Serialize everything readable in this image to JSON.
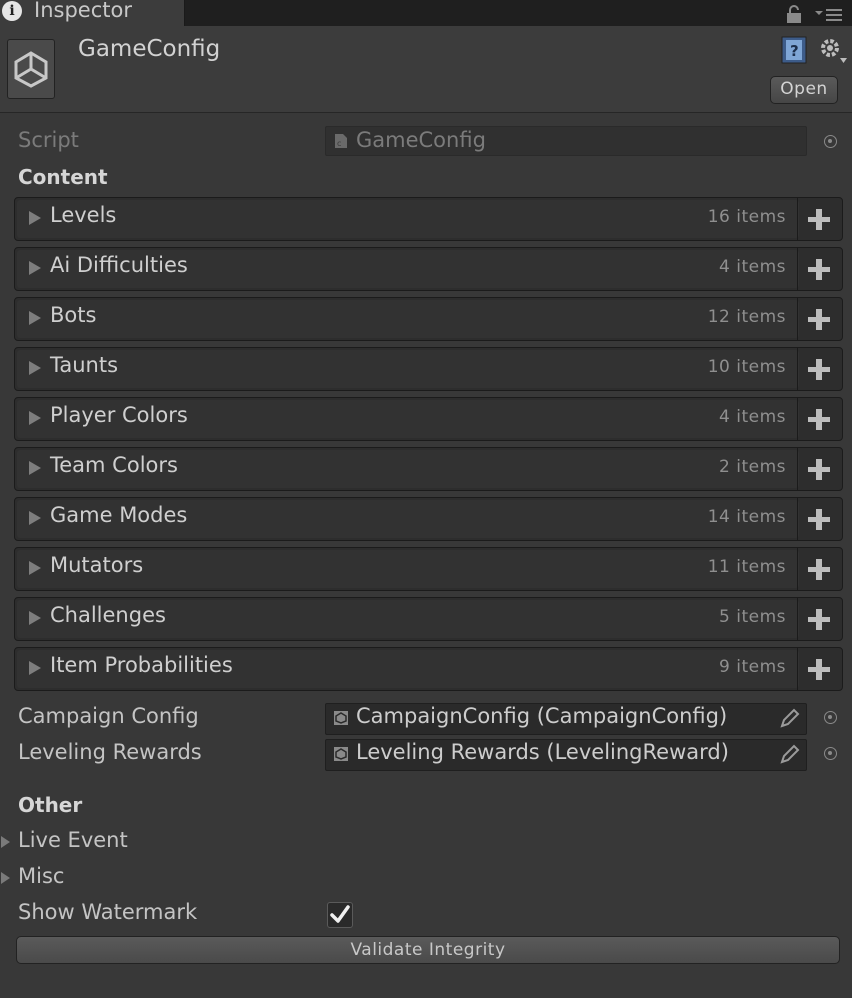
{
  "tab": {
    "title": "Inspector",
    "icon": "info-icon",
    "info_glyph": "i"
  },
  "header": {
    "asset_name": "GameConfig",
    "open_label": "Open"
  },
  "script": {
    "label": "Script",
    "value": "GameConfig"
  },
  "content": {
    "heading": "Content",
    "lists": [
      {
        "label": "Levels",
        "count": "16 items"
      },
      {
        "label": "Ai Difficulties",
        "count": "4 items"
      },
      {
        "label": "Bots",
        "count": "12 items"
      },
      {
        "label": "Taunts",
        "count": "10 items"
      },
      {
        "label": "Player Colors",
        "count": "4 items"
      },
      {
        "label": "Team Colors",
        "count": "2 items"
      },
      {
        "label": "Game Modes",
        "count": "14 items"
      },
      {
        "label": "Mutators",
        "count": "11 items"
      },
      {
        "label": "Challenges",
        "count": "5 items"
      },
      {
        "label": "Item Probabilities",
        "count": "9 items"
      }
    ]
  },
  "fields": {
    "campaign_config": {
      "label": "Campaign Config",
      "value": "CampaignConfig (CampaignConfig)"
    },
    "leveling_rewards": {
      "label": "Leveling Rewards",
      "value": "Leveling Rewards (LevelingReward)"
    }
  },
  "other": {
    "heading": "Other",
    "live_event": "Live Event",
    "misc": "Misc",
    "show_watermark": {
      "label": "Show Watermark",
      "checked": true
    }
  },
  "validate_label": "Validate Integrity"
}
